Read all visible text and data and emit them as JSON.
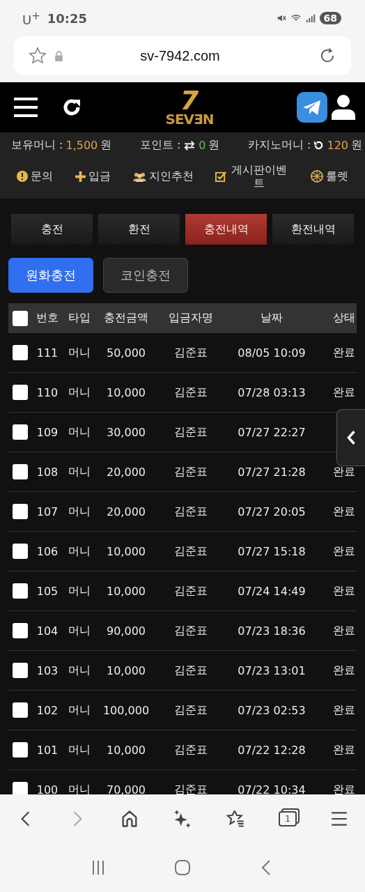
{
  "status_bar": {
    "carrier": "U$^{+}$",
    "time": "10:25",
    "battery": "68"
  },
  "browser": {
    "url": "sv-7942.com",
    "tab_count": "1"
  },
  "header": {
    "logo": {
      "numeral": "7",
      "word": "SEVƎN"
    }
  },
  "balances": [
    {
      "kind": "money",
      "label": "보유머니 :",
      "value": "1,500",
      "unit": "원"
    },
    {
      "kind": "point",
      "label": "포인트 :",
      "value": "0",
      "unit": "원"
    },
    {
      "kind": "casino",
      "label": "카지노머니 :",
      "value": "120",
      "unit": "원"
    }
  ],
  "menu": [
    {
      "kind": "inquiry",
      "label": "문의"
    },
    {
      "kind": "deposit",
      "label": "입금"
    },
    {
      "kind": "referral",
      "label": "지인추천"
    },
    {
      "kind": "board",
      "label": "게시판이벤트"
    },
    {
      "kind": "roulette",
      "label": "룰렛"
    }
  ],
  "tabs": [
    {
      "label": "충전",
      "selected": false
    },
    {
      "label": "환전",
      "selected": false
    },
    {
      "label": "충전내역",
      "selected": true
    },
    {
      "label": "환전내역",
      "selected": false
    }
  ],
  "subtabs": [
    {
      "label": "원화충전",
      "selected": true
    },
    {
      "label": "코인충전",
      "selected": false
    }
  ],
  "table": {
    "select_all": {
      "checked": false
    },
    "columns": [
      "번호",
      "타입",
      "충전금액",
      "입금자명",
      "날짜",
      "상태"
    ],
    "rows": [
      {
        "checked": false,
        "cells": [
          "111",
          "머니",
          "50,000",
          "김준표",
          "08/05 10:09",
          "완료"
        ]
      },
      {
        "checked": false,
        "cells": [
          "110",
          "머니",
          "10,000",
          "김준표",
          "07/28 03:13",
          "완료"
        ]
      },
      {
        "checked": false,
        "cells": [
          "109",
          "머니",
          "30,000",
          "김준표",
          "07/27 22:27"
        ]
      },
      {
        "checked": false,
        "cells": [
          "108",
          "머니",
          "20,000",
          "김준표",
          "07/27 21:28",
          "완료"
        ]
      },
      {
        "checked": false,
        "cells": [
          "107",
          "머니",
          "20,000",
          "김준표",
          "07/27 20:05",
          "완료"
        ]
      },
      {
        "checked": false,
        "cells": [
          "106",
          "머니",
          "10,000",
          "김준표",
          "07/27 15:18",
          "완료"
        ]
      },
      {
        "checked": false,
        "cells": [
          "105",
          "머니",
          "10,000",
          "김준표",
          "07/24 14:49",
          "완료"
        ]
      },
      {
        "checked": false,
        "cells": [
          "104",
          "머니",
          "90,000",
          "김준표",
          "07/23 18:36",
          "완료"
        ]
      },
      {
        "checked": false,
        "cells": [
          "103",
          "머니",
          "10,000",
          "김준표",
          "07/23 13:01",
          "완료"
        ]
      },
      {
        "checked": false,
        "cells": [
          "102",
          "머니",
          "100,000",
          "김준표",
          "07/23 02:53",
          "완료"
        ]
      },
      {
        "checked": false,
        "cells": [
          "101",
          "머니",
          "10,000",
          "김준표",
          "07/22 12:28",
          "완료"
        ]
      },
      {
        "checked": false,
        "cells": [
          "100",
          "머니",
          "70,000",
          "김준표",
          "07/22 10:34",
          "완료"
        ]
      }
    ]
  }
}
